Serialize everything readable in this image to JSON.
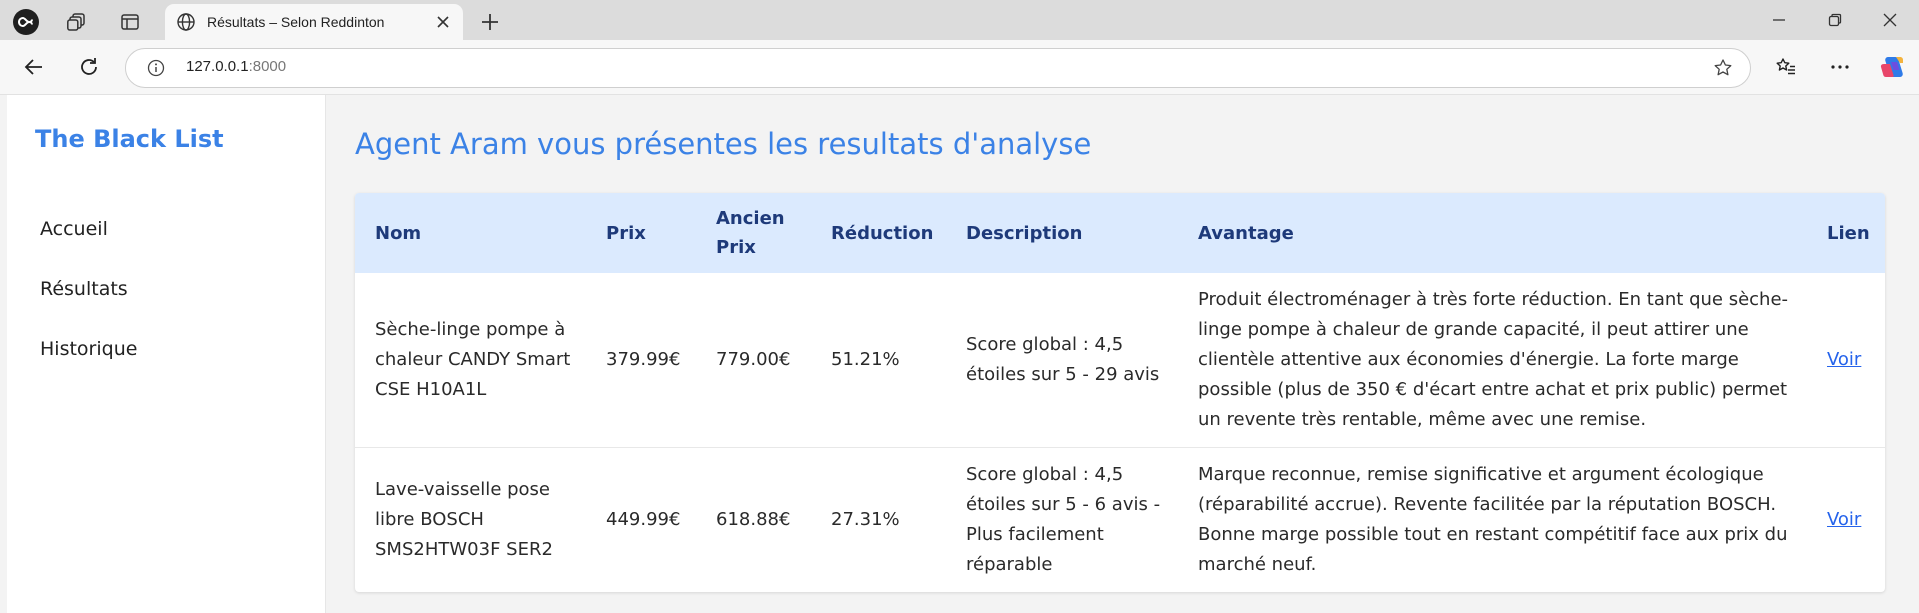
{
  "browser": {
    "tab_title": "Résultats – Selon Reddinton",
    "url_host": "127.0.0.1",
    "url_port": ":8000"
  },
  "sidebar": {
    "brand": "The Black List",
    "items": [
      {
        "label": "Accueil"
      },
      {
        "label": "Résultats"
      },
      {
        "label": "Historique"
      }
    ]
  },
  "main": {
    "title": "Agent Aram vous présentes les resultats d'analyse"
  },
  "table": {
    "headers": {
      "nom": "Nom",
      "prix": "Prix",
      "ancien_prix": "Ancien Prix",
      "reduction": "Réduction",
      "description": "Description",
      "avantage": "Avantage",
      "lien": "Lien"
    },
    "rows": [
      {
        "nom": "Sèche-linge pompe à chaleur CANDY Smart CSE H10A1L",
        "prix": "379.99€",
        "ancien_prix": "779.00€",
        "reduction": "51.21%",
        "description": "Score global : 4,5 étoiles sur 5 - 29 avis",
        "avantage": "Produit électroménager à très forte réduction. En tant que sèche-linge pompe à chaleur de grande capacité, il peut attirer une clientèle attentive aux économies d'énergie. La forte marge possible (plus de 350 € d'écart entre achat et prix public) permet un revente très rentable, même avec une remise.",
        "lien": "Voir"
      },
      {
        "nom": "Lave-vaisselle pose libre BOSCH SMS2HTW03F SER2",
        "prix": "449.99€",
        "ancien_prix": "618.88€",
        "reduction": "27.31%",
        "description": "Score global : 4,5 étoiles sur 5 - 6 avis - Plus facilement réparable",
        "avantage": "Marque reconnue, remise significative et argument écologique (réparabilité accrue). Revente facilitée par la réputation BOSCH. Bonne marge possible tout en restant compétitif face aux prix du marché neuf.",
        "lien": "Voir"
      }
    ]
  },
  "colors": {
    "accent": "#3b82e6",
    "table_header_bg": "#dbeafe",
    "table_header_text": "#1e3a7a",
    "link": "#2563eb"
  }
}
